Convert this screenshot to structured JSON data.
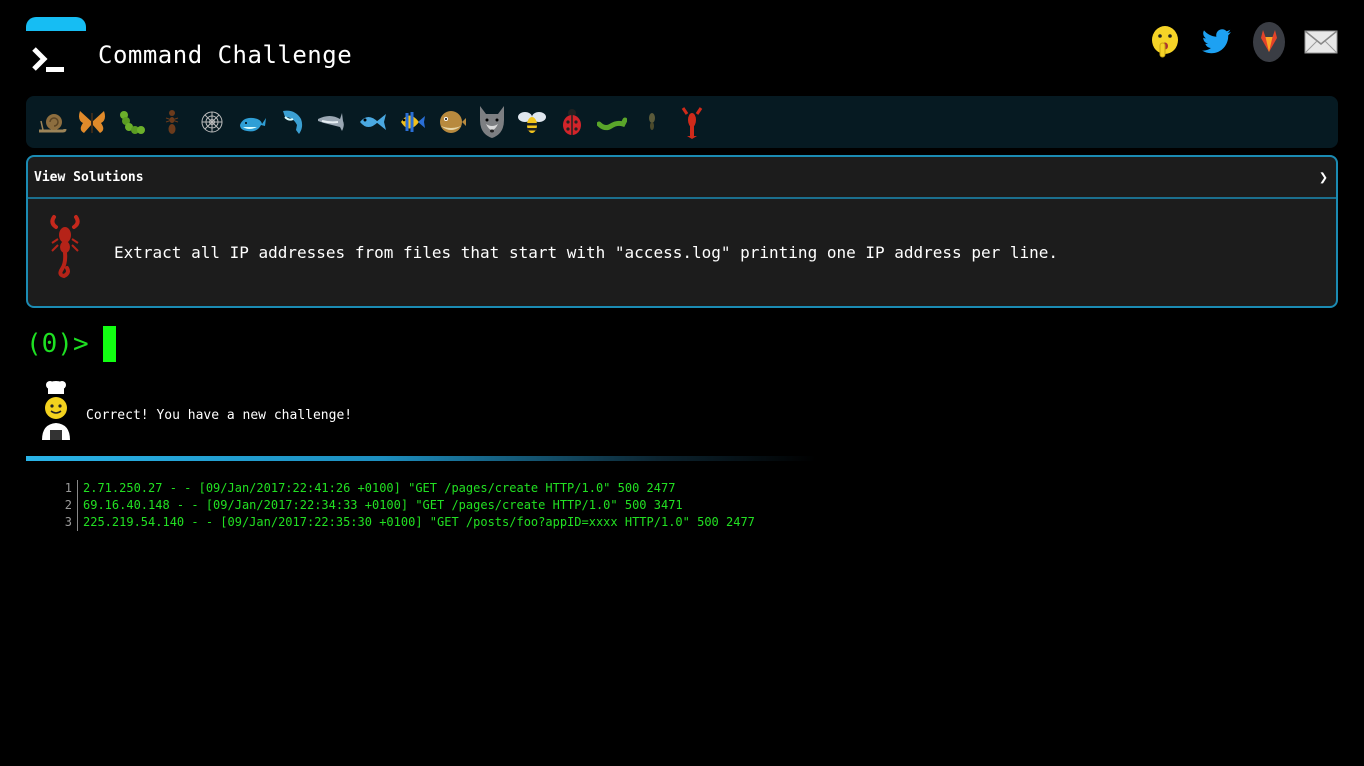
{
  "header": {
    "title": "Command Challenge",
    "social": [
      {
        "name": "hush-emoji-icon"
      },
      {
        "name": "twitter-icon"
      },
      {
        "name": "gitlab-icon"
      },
      {
        "name": "mail-icon"
      }
    ]
  },
  "strip": {
    "icons": [
      "snail",
      "butterfly",
      "caterpillar",
      "ant",
      "spider-web",
      "whale",
      "dolphin-leaping",
      "dolphin",
      "fish",
      "tropical-fish",
      "blowfish",
      "wolf",
      "bee",
      "ladybug",
      "worm",
      "cricket",
      "lobster"
    ]
  },
  "challenge": {
    "toggle_label": "View Solutions",
    "chevron": "❯",
    "icon": "scorpion",
    "description": "Extract all IP addresses from files that start with \"access.log\" printing one IP address per line."
  },
  "prompt": {
    "text": "(0)>"
  },
  "message": {
    "text": "Correct! You have a new challenge!"
  },
  "log": {
    "lines": [
      {
        "num": "1",
        "text": "2.71.250.27 - - [09/Jan/2017:22:41:26 +0100] \"GET /pages/create HTTP/1.0\" 500 2477"
      },
      {
        "num": "2",
        "text": "69.16.40.148 - - [09/Jan/2017:22:34:33 +0100] \"GET /pages/create HTTP/1.0\" 500 3471"
      },
      {
        "num": "3",
        "text": "225.219.54.140 - - [09/Jan/2017:22:35:30 +0100] \"GET /posts/foo?appID=xxxx HTTP/1.0\" 500 2477"
      }
    ]
  },
  "colors": {
    "accent": "#16bdf3",
    "prompt_green": "#1ee022",
    "panel_bg": "#1c1c1c",
    "strip_bg": "#061a22"
  }
}
